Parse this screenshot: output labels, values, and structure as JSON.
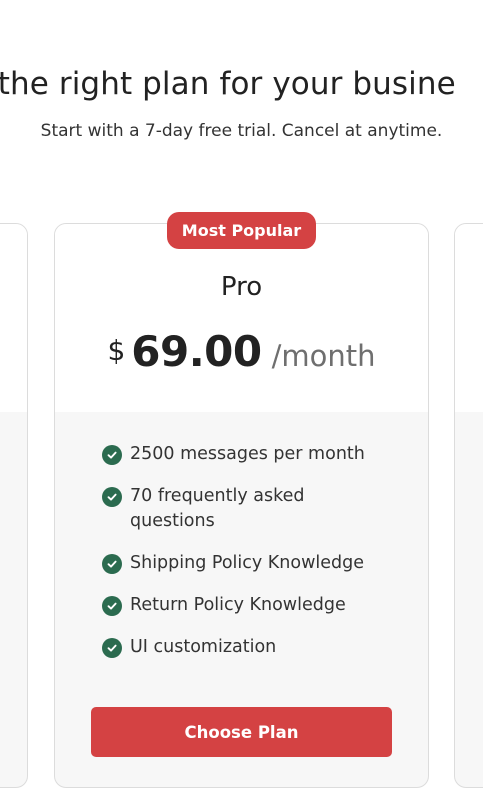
{
  "header": {
    "headline": "d the right plan for your busine",
    "subtitle": "Start with a 7-day free trial. Cancel at anytime."
  },
  "plan": {
    "badge": "Most Popular",
    "name": "Pro",
    "currency": "$",
    "amount": "69.00",
    "period": "/month",
    "features": [
      "2500 messages per month",
      "70 frequently asked questions",
      "Shipping Policy Knowledge",
      "Return Policy Knowledge",
      "UI customization"
    ],
    "cta_label": "Choose Plan"
  },
  "icons": {
    "feature_icon": "check-circle-icon"
  },
  "colors": {
    "accent": "#d44243",
    "check": "#2b6b4f",
    "period_text": "#6f6f6f",
    "card_bottom": "#f7f7f7",
    "card_border": "#dcdcdc"
  }
}
